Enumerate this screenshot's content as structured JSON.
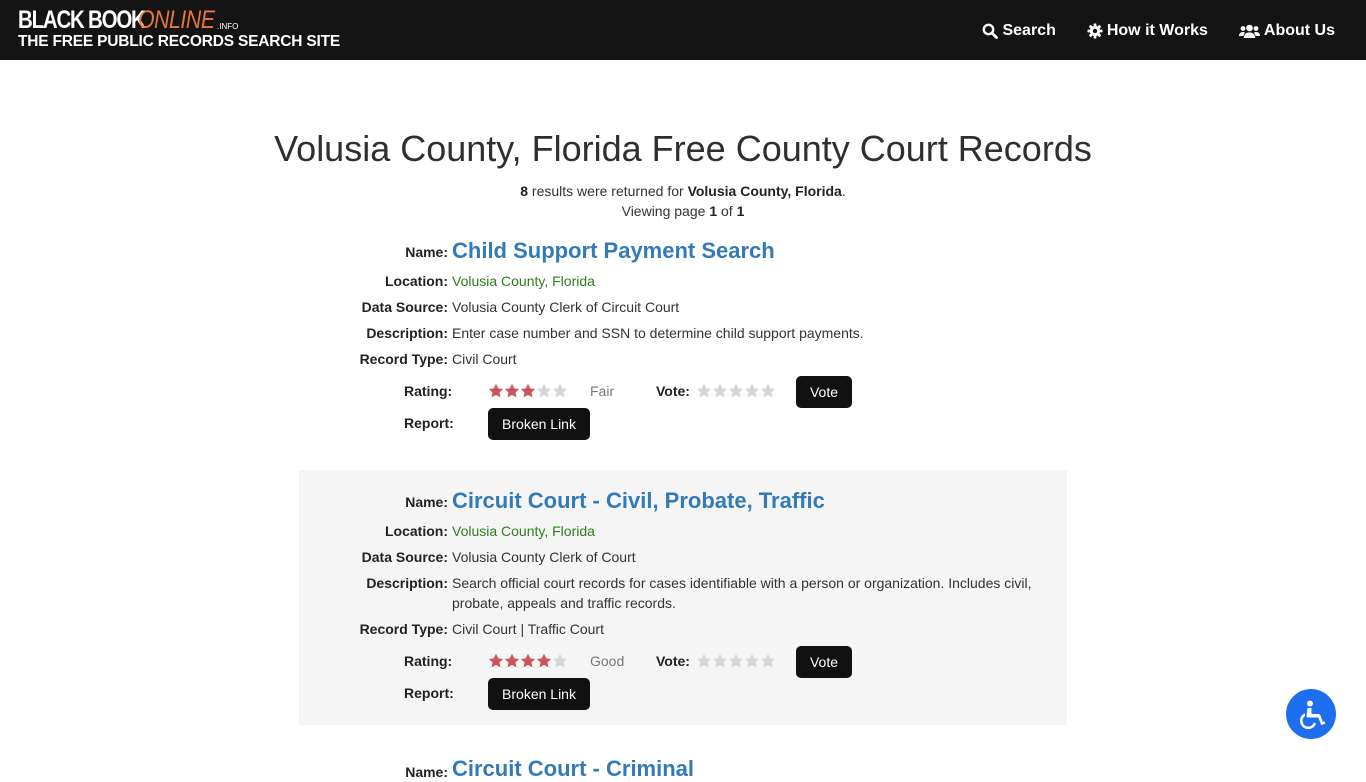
{
  "header": {
    "logo_black_book": "BLACK BOOK",
    "logo_online": "ONLINE",
    "logo_info": ".INFO",
    "logo_tagline": "THE FREE PUBLIC RECORDS SEARCH SITE",
    "nav": [
      {
        "label": "Search",
        "icon": "search-icon"
      },
      {
        "label": "How it Works",
        "icon": "gear-icon"
      },
      {
        "label": "About Us",
        "icon": "users-icon"
      }
    ]
  },
  "page": {
    "title": "Volusia County, Florida Free County Court Records",
    "result_count": "8",
    "results_text": " results were returned for ",
    "query_location": "Volusia County, Florida",
    "period": ".",
    "viewing_prefix": "Viewing page ",
    "current_page": "1",
    "of_text": " of ",
    "total_pages": "1"
  },
  "labels": {
    "name": "Name:",
    "location": "Location:",
    "data_source": "Data Source:",
    "description": "Description:",
    "record_type": "Record Type:",
    "rating": "Rating:",
    "vote": "Vote:",
    "report": "Report:",
    "vote_button": "Vote",
    "broken_link_button": "Broken Link"
  },
  "records": [
    {
      "name": "Child Support Payment Search",
      "location": "Volusia County, Florida",
      "data_source": "Volusia County Clerk of Circuit Court",
      "description": "Enter case number and SSN to determine child support payments.",
      "record_type": "Civil Court",
      "rating_stars": 3,
      "rating_max": 5,
      "rating_word": "Fair",
      "vote_stars": 0
    },
    {
      "name": "Circuit Court - Civil, Probate, Traffic",
      "location": "Volusia County, Florida",
      "data_source": "Volusia County Clerk of Court",
      "description": "Search official court records for cases identifiable with a person or organization. Includes civil, probate, appeals and traffic records.",
      "record_type": "Civil Court | Traffic Court",
      "rating_stars": 4,
      "rating_max": 5,
      "rating_word": "Good",
      "vote_stars": 0
    },
    {
      "name": "Circuit Court - Criminal",
      "label": "Name:"
    }
  ],
  "colors": {
    "header_bg": "#141414",
    "logo_accent": "#e8773a",
    "link_blue": "#337ab7",
    "location_green": "#2e7d1e",
    "star_filled": "#c9545c",
    "star_empty": "#d6d6d6",
    "button_bg": "#111111",
    "accessibility_blue": "#1d6ff0"
  },
  "accessibility_button": {
    "icon": "wheelchair-icon"
  }
}
